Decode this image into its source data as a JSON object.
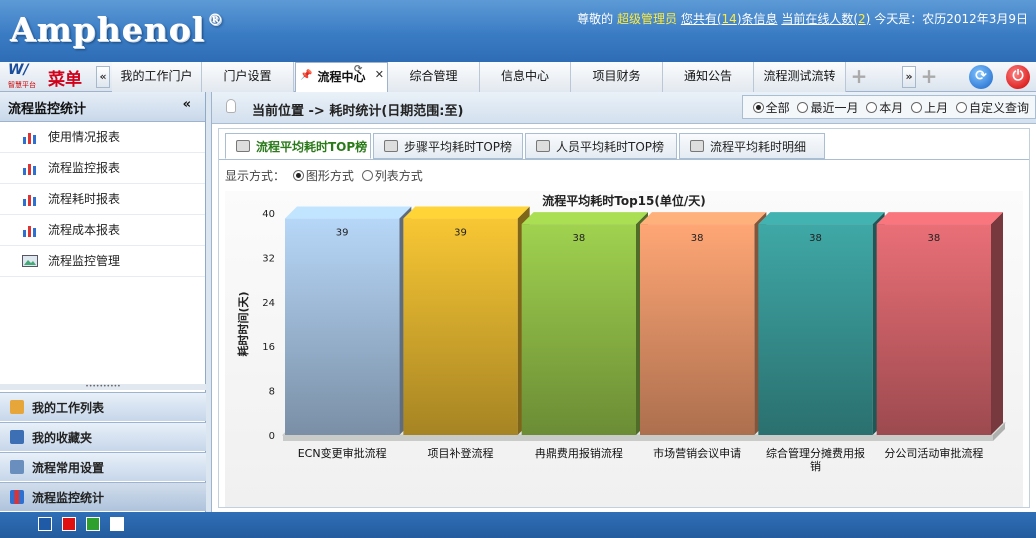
{
  "header": {
    "logo": "Amphenol",
    "registered": "®",
    "greeting": "尊敬的",
    "role": "超级管理员",
    "msg_prefix": "您共有(",
    "msg_count": "14",
    "msg_suffix": ")条信息",
    "online_prefix": "当前在线人数(",
    "online_count": "2",
    "online_suffix": ")",
    "today": "今天是：农历2012年3月9日"
  },
  "menu": {
    "logo_w": "W/",
    "logo_sub": "智慧平台",
    "label": "菜单",
    "tabs": [
      "我的工作门户",
      "门户设置",
      "流程中心",
      "综合管理",
      "信息中心",
      "项目财务",
      "通知公告",
      "流程测试流转"
    ],
    "active_tab": "流程中心"
  },
  "sidebar": {
    "title": "流程监控统计",
    "collapse": "«",
    "items": [
      "使用情况报表",
      "流程监控报表",
      "流程耗时报表",
      "流程成本报表",
      "流程监控管理"
    ],
    "accordion": [
      "我的工作列表",
      "我的收藏夹",
      "流程常用设置",
      "流程监控统计"
    ]
  },
  "breadcrumb": {
    "text": "当前位置 -> 耗时统计(日期范围:至)",
    "filters": [
      "全部",
      "最近一月",
      "本月",
      "上月",
      "自定义查询"
    ],
    "selected": "全部"
  },
  "subtabs": {
    "items": [
      "流程平均耗时TOP榜",
      "步骤平均耗时TOP榜",
      "人员平均耗时TOP榜",
      "流程平均耗时明细"
    ],
    "active": "流程平均耗时TOP榜"
  },
  "display": {
    "label": "显示方式：",
    "options": [
      "图形方式",
      "列表方式"
    ],
    "selected": "图形方式"
  },
  "footer": {
    "theme_colors": [
      "#1f5aa6",
      "#e01010",
      "#2da02d",
      "#ffffff"
    ]
  },
  "chart_data": {
    "type": "bar",
    "title": "流程平均耗时Top15(单位/天)",
    "ylabel": "耗时时间(天)",
    "xlabel": "",
    "ylim": [
      0,
      40
    ],
    "yticks": [
      0,
      8,
      16,
      24,
      32,
      40
    ],
    "categories": [
      "ECN变更审批流程",
      "项目补登流程",
      "冉鼎费用报销流程",
      "市场营销会议申请",
      "综合管理分摊费用报销",
      "分公司活动审批流程"
    ],
    "values": [
      39,
      39,
      38,
      38,
      38,
      38
    ],
    "colors": [
      "#a9c7e6",
      "#e6b830",
      "#94c249",
      "#ef9a6c",
      "#3a9c9a",
      "#d9676e"
    ],
    "grid": false,
    "legend": "none"
  }
}
